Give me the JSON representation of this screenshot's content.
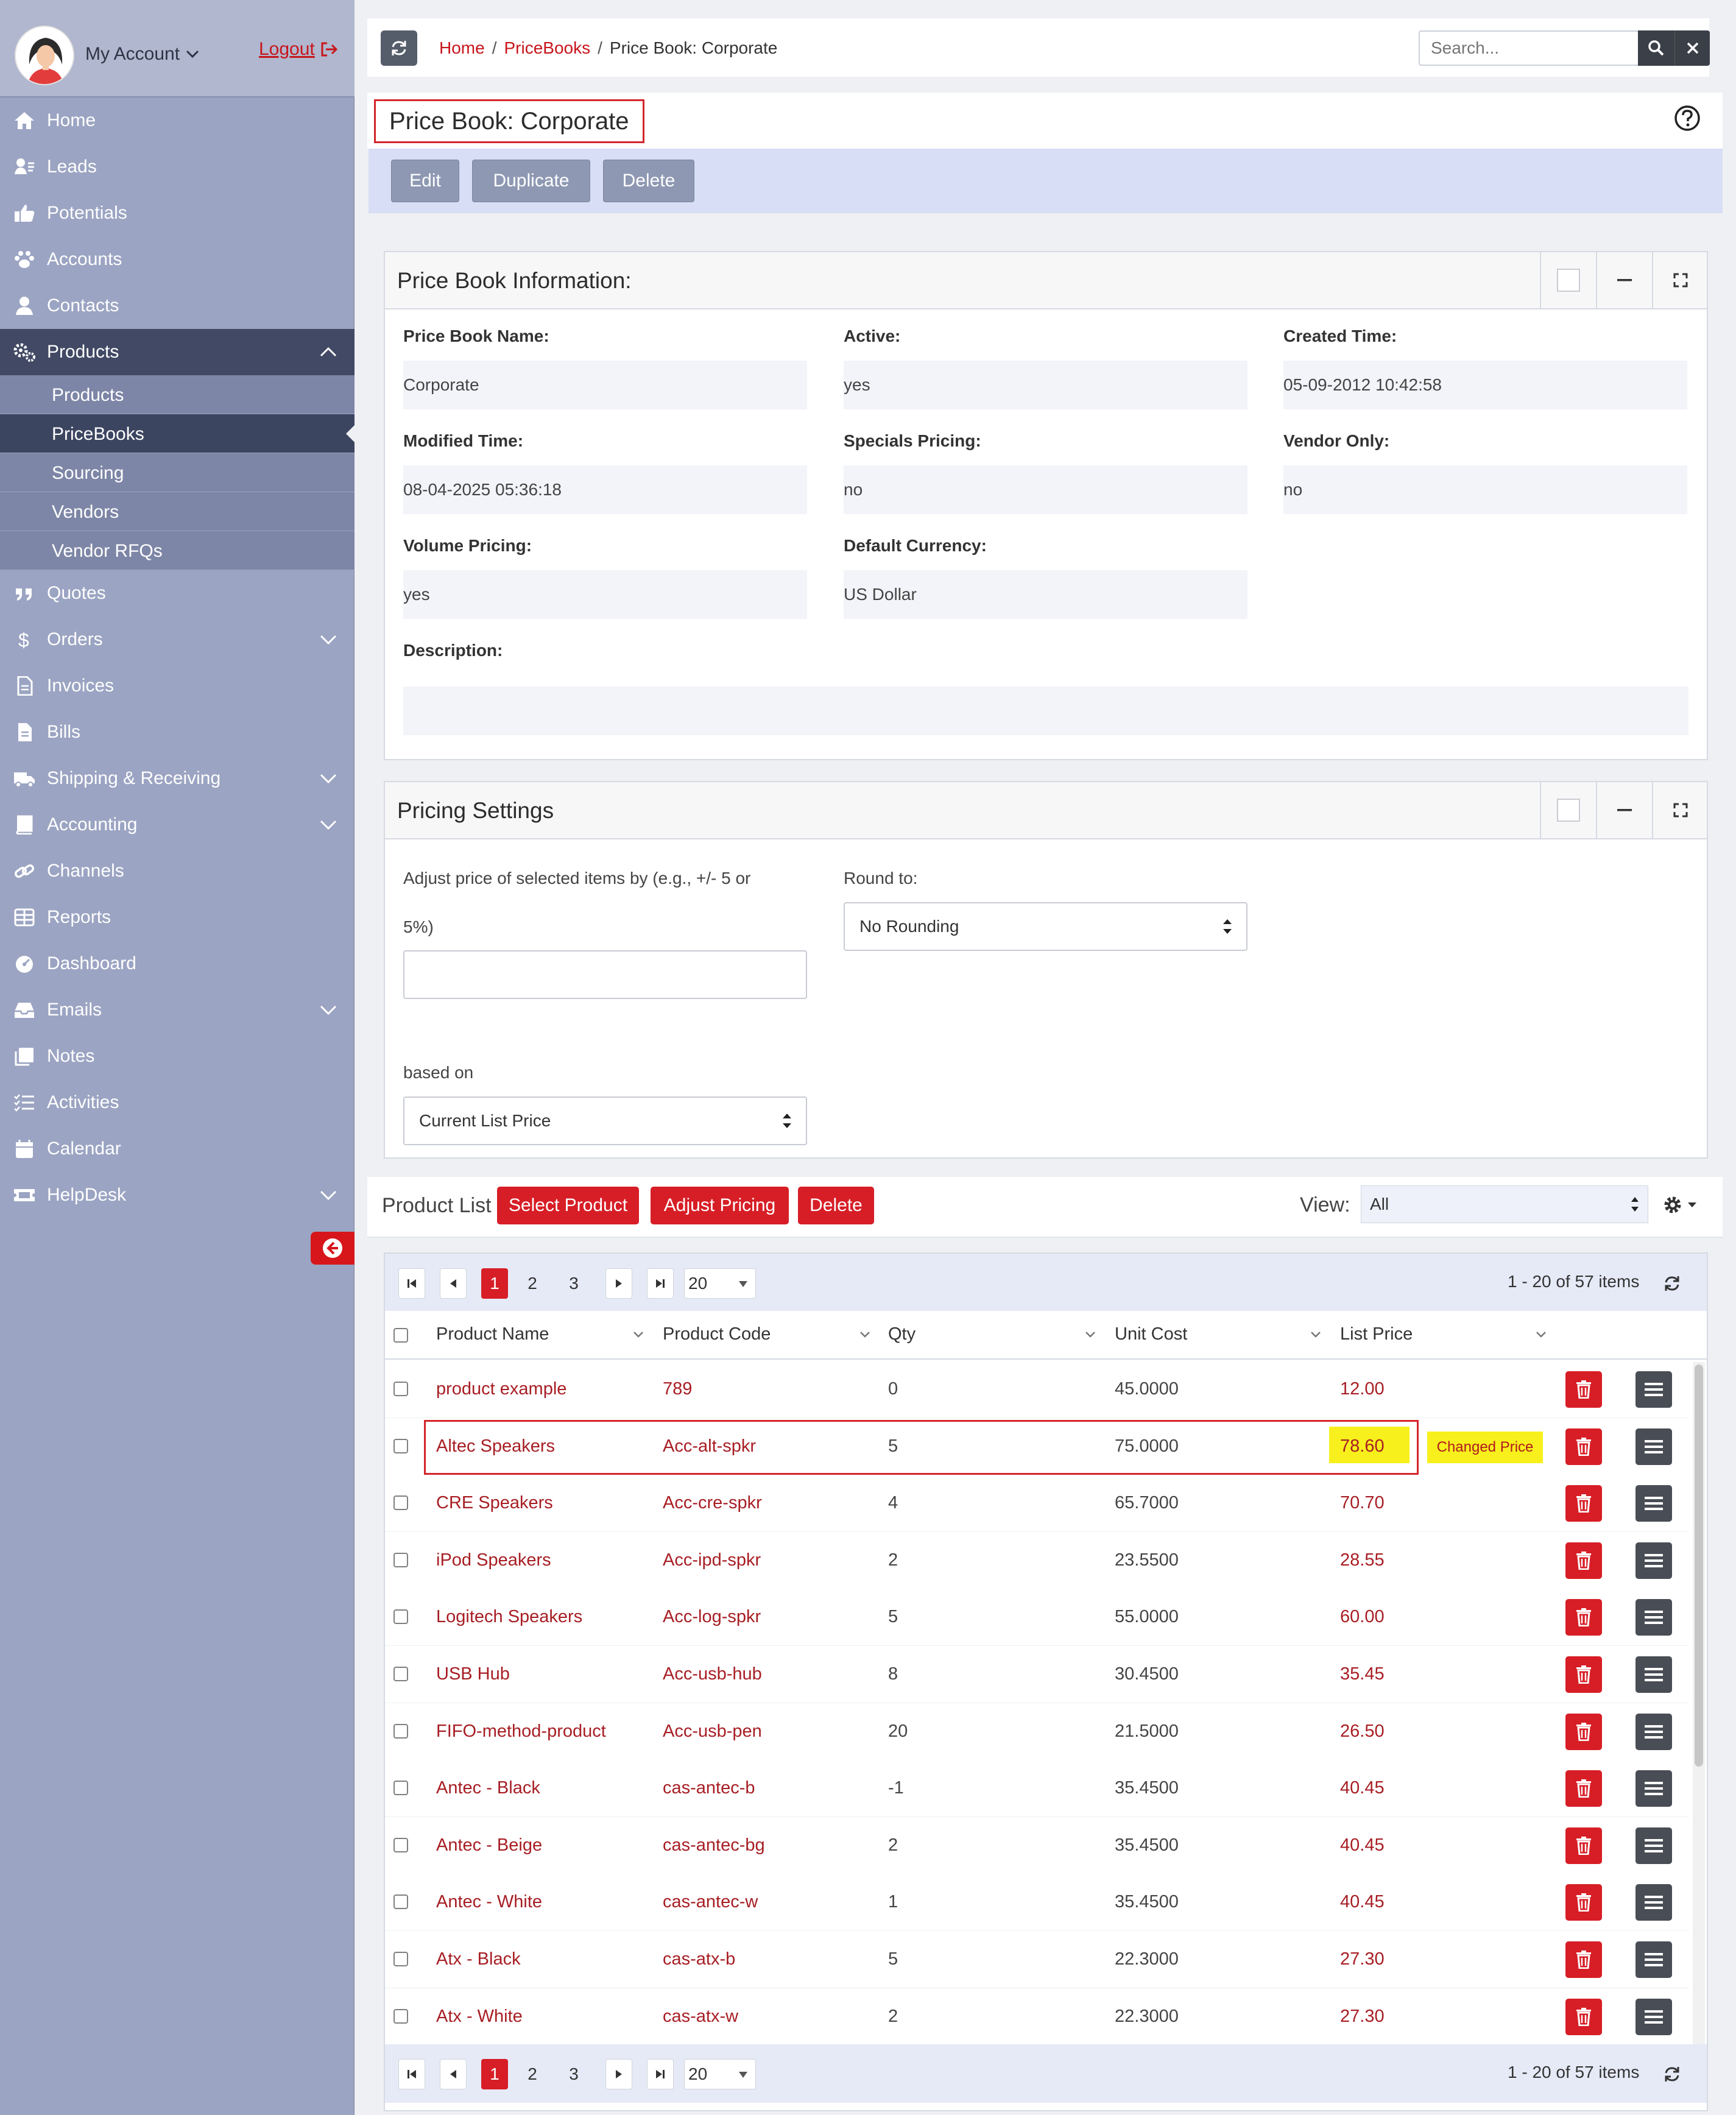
{
  "sidebar": {
    "account_label": "My Account",
    "logout_label": "Logout",
    "items": [
      {
        "label": "Home",
        "icon": "home-icon"
      },
      {
        "label": "Leads",
        "icon": "leads-icon"
      },
      {
        "label": "Potentials",
        "icon": "thumbs-up-icon"
      },
      {
        "label": "Accounts",
        "icon": "paw-icon"
      },
      {
        "label": "Contacts",
        "icon": "user-icon"
      },
      {
        "label": "Products",
        "icon": "gears-icon"
      },
      {
        "label": "Quotes",
        "icon": "quote-icon"
      },
      {
        "label": "Orders",
        "icon": "dollar-icon"
      },
      {
        "label": "Invoices",
        "icon": "file-icon"
      },
      {
        "label": "Bills",
        "icon": "bill-icon"
      },
      {
        "label": "Shipping & Receiving",
        "icon": "truck-icon"
      },
      {
        "label": "Accounting",
        "icon": "book-icon"
      },
      {
        "label": "Channels",
        "icon": "link-icon"
      },
      {
        "label": "Reports",
        "icon": "table-icon"
      },
      {
        "label": "Dashboard",
        "icon": "dashboard-icon"
      },
      {
        "label": "Emails",
        "icon": "inbox-icon"
      },
      {
        "label": "Notes",
        "icon": "notes-icon"
      },
      {
        "label": "Activities",
        "icon": "checklist-icon"
      },
      {
        "label": "Calendar",
        "icon": "calendar-icon"
      },
      {
        "label": "HelpDesk",
        "icon": "ticket-icon"
      }
    ],
    "products_sub": [
      "Products",
      "PriceBooks",
      "Sourcing",
      "Vendors",
      "Vendor RFQs"
    ]
  },
  "topbar": {
    "breadcrumb": [
      "Home",
      "PriceBooks",
      "Price Book: Corporate"
    ],
    "search_placeholder": "Search..."
  },
  "page": {
    "title": "Price Book: Corporate",
    "actions": [
      "Edit",
      "Duplicate",
      "Delete"
    ]
  },
  "info_panel": {
    "title": "Price Book Information:",
    "fields": [
      {
        "label": "Price Book Name:",
        "value": "Corporate"
      },
      {
        "label": "Active:",
        "value": "yes"
      },
      {
        "label": "Created Time:",
        "value": "05-09-2012 10:42:58"
      },
      {
        "label": "Modified Time:",
        "value": "08-04-2025 05:36:18"
      },
      {
        "label": "Specials Pricing:",
        "value": "no"
      },
      {
        "label": "Vendor Only:",
        "value": "no"
      },
      {
        "label": "Volume Pricing:",
        "value": "yes"
      },
      {
        "label": "Default Currency:",
        "value": "US Dollar"
      },
      {
        "label": "Description:",
        "value": ""
      }
    ]
  },
  "pricing_panel": {
    "title": "Pricing Settings",
    "adjust_label_1": "Adjust price of selected items by (e.g., +/- 5 or",
    "adjust_label_2": "5%)",
    "adjust_value": "",
    "round_label": "Round to:",
    "round_value": "No Rounding",
    "based_label": "based on",
    "based_value": "Current List Price"
  },
  "product_list": {
    "label": "Product List",
    "buttons": [
      "Select Product",
      "Adjust Pricing",
      "Delete"
    ],
    "view_label": "View:",
    "view_value": "All",
    "pager": {
      "pages": [
        "1",
        "2",
        "3"
      ],
      "current": "1",
      "page_size": "20",
      "info": "1 - 20 of 57 items"
    },
    "columns": [
      "Product Name",
      "Product Code",
      "Qty",
      "Unit Cost",
      "List Price"
    ],
    "rows": [
      {
        "name": "product example",
        "code": "789",
        "qty": "0",
        "cost": "45.0000",
        "price": "12.00"
      },
      {
        "name": "Altec Speakers",
        "code": "Acc-alt-spkr",
        "qty": "5",
        "cost": "75.0000",
        "price": "78.60"
      },
      {
        "name": "CRE Speakers",
        "code": "Acc-cre-spkr",
        "qty": "4",
        "cost": "65.7000",
        "price": "70.70"
      },
      {
        "name": "iPod Speakers",
        "code": "Acc-ipd-spkr",
        "qty": "2",
        "cost": "23.5500",
        "price": "28.55"
      },
      {
        "name": "Logitech Speakers",
        "code": "Acc-log-spkr",
        "qty": "5",
        "cost": "55.0000",
        "price": "60.00"
      },
      {
        "name": "USB Hub",
        "code": "Acc-usb-hub",
        "qty": "8",
        "cost": "30.4500",
        "price": "35.45"
      },
      {
        "name": "FIFO-method-product",
        "code": "Acc-usb-pen",
        "qty": "20",
        "cost": "21.5000",
        "price": "26.50"
      },
      {
        "name": "Antec - Black",
        "code": "cas-antec-b",
        "qty": "-1",
        "cost": "35.4500",
        "price": "40.45"
      },
      {
        "name": "Antec - Beige",
        "code": "cas-antec-bg",
        "qty": "2",
        "cost": "35.4500",
        "price": "40.45"
      },
      {
        "name": "Antec - White",
        "code": "cas-antec-w",
        "qty": "1",
        "cost": "35.4500",
        "price": "40.45"
      },
      {
        "name": "Atx - Black",
        "code": "cas-atx-b",
        "qty": "5",
        "cost": "22.3000",
        "price": "27.30"
      },
      {
        "name": "Atx - White",
        "code": "cas-atx-w",
        "qty": "2",
        "cost": "22.3000",
        "price": "27.30"
      }
    ],
    "annotation": "Changed Price"
  },
  "colors": {
    "accent_red": "#d71e26",
    "sidebar": "#9ba4c2",
    "highlight_yellow": "#f8f01c"
  }
}
